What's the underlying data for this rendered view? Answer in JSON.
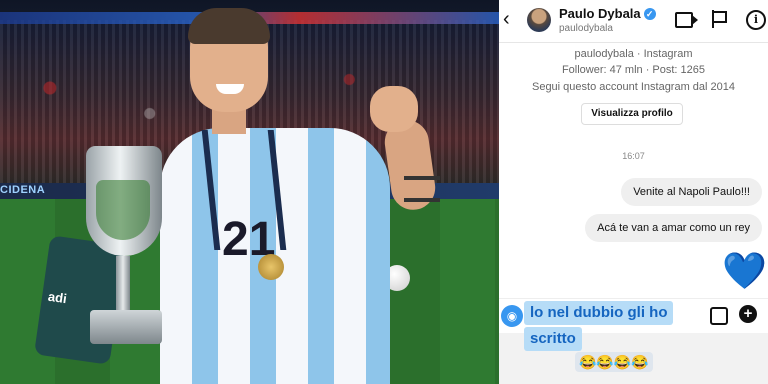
{
  "photo": {
    "ad_text": "CIDENA",
    "jersey_number": "21",
    "cloth_text": "adi"
  },
  "header": {
    "back_glyph": "‹",
    "name": "Paulo Dybala",
    "verified_glyph": "✓",
    "handle": "paulodybala",
    "info_glyph": "i"
  },
  "profile": {
    "cut_text": "paulodybala",
    "line1": "paulodybala · Instagram",
    "line2": "Follower: 47 mln · Post: 1265",
    "line3": "Segui questo account Instagram dal 2014",
    "view_button": "Visualizza profilo"
  },
  "messages": {
    "timestamp": "16:07",
    "items": [
      "Venite al Napoli Paulo!!!",
      "Acá te van a amar como un rey"
    ],
    "heart": "💙"
  },
  "composer": {
    "camera_glyph": "◉",
    "plus_glyph": "+"
  },
  "caption": {
    "line1": "lo nel dubbio gli ho",
    "line2": "scritto",
    "emojis": "😂😂😂😂"
  },
  "colors": {
    "accent": "#3897f0",
    "caption_text": "#1565c0",
    "heart": "#2a7bd8"
  }
}
